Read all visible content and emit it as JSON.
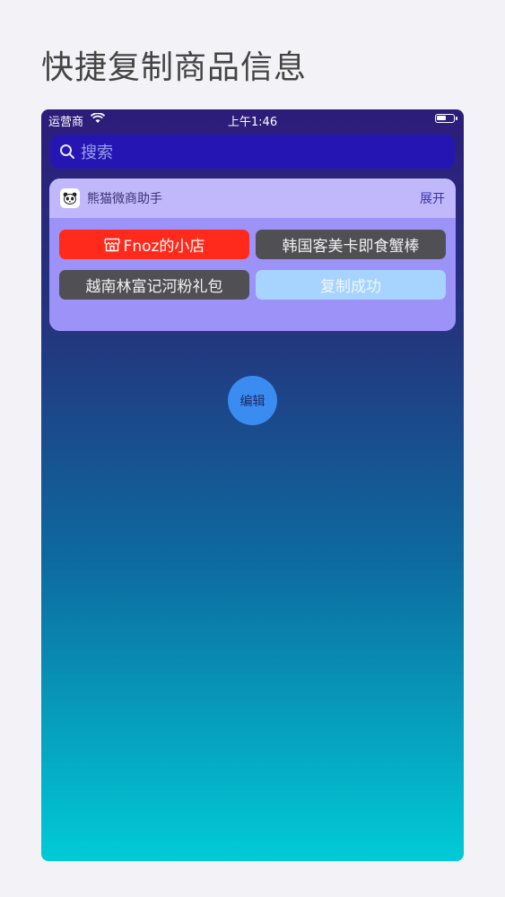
{
  "page": {
    "title": "快捷复制商品信息"
  },
  "status_bar": {
    "carrier": "运营商",
    "time": "上午1:46"
  },
  "search": {
    "placeholder": "搜索"
  },
  "widget": {
    "app_name": "熊猫微商助手",
    "expand_label": "展开",
    "items": [
      {
        "label": "Fnoz的小店",
        "icon": "store-icon"
      },
      {
        "label": "韩国客美卡即食蟹棒"
      },
      {
        "label": "越南林富记河粉礼包"
      },
      {
        "label": "复制成功"
      }
    ]
  },
  "edit": {
    "label": "编辑"
  },
  "colors": {
    "store_chip": "#ff2a1c",
    "dark_chip": "#4f4f54",
    "success_chip": "#a7d4ff",
    "edit_button": "#3b8cf0"
  }
}
